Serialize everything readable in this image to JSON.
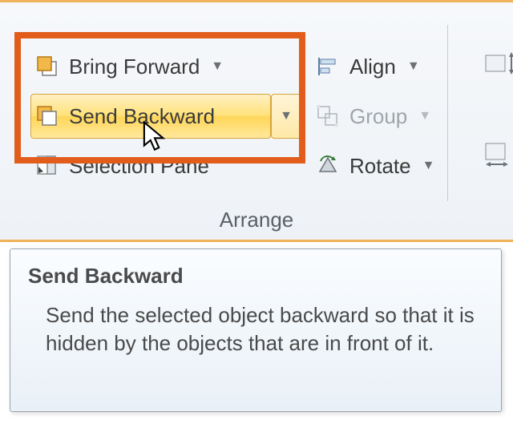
{
  "ribbon": {
    "group_label": "Arrange",
    "bring_forward": {
      "label": "Bring Forward"
    },
    "send_backward": {
      "label": "Send Backward"
    },
    "selection_pane": {
      "label": "Selection Pane"
    },
    "align": {
      "label": "Align"
    },
    "group": {
      "label": "Group"
    },
    "rotate": {
      "label": "Rotate"
    }
  },
  "tooltip": {
    "title": "Send Backward",
    "desc": "Send the selected object backward so that it is hidden by the objects that are in front of it."
  }
}
